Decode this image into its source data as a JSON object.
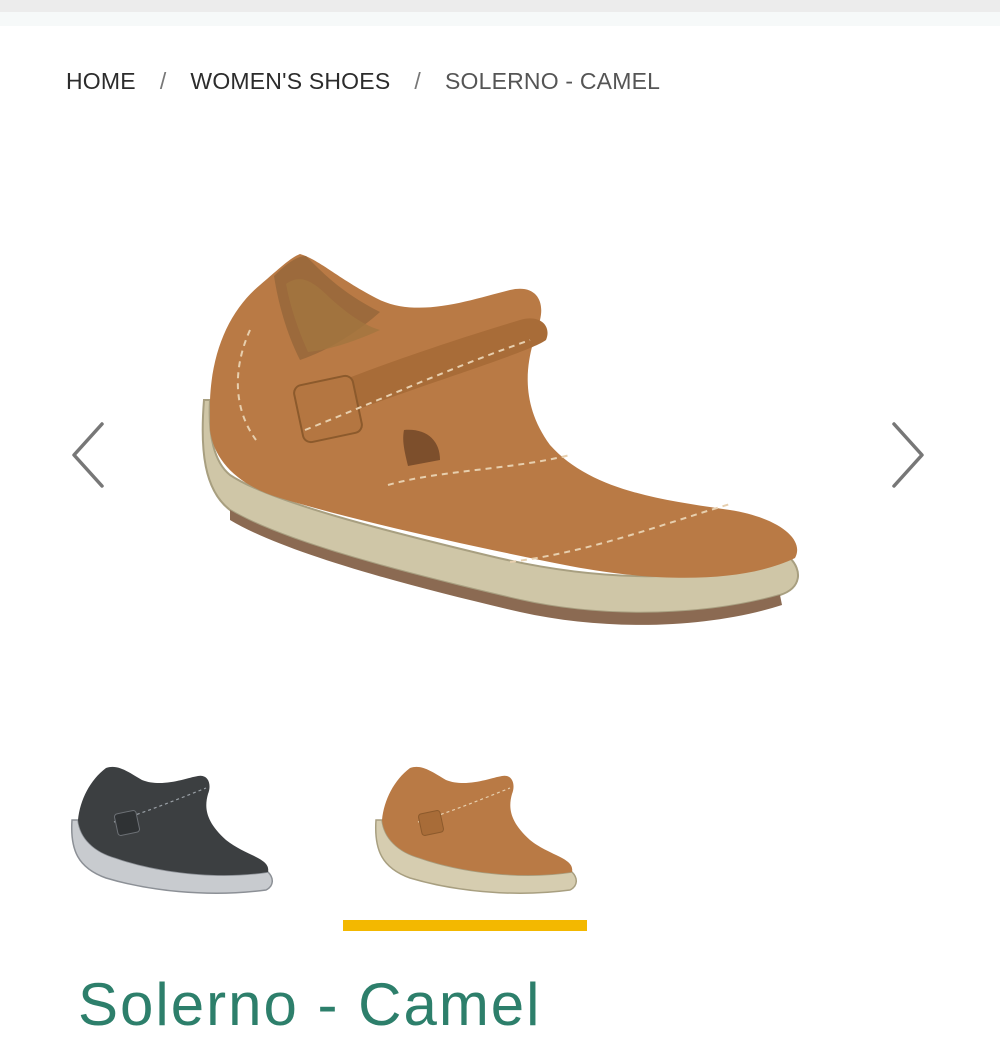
{
  "breadcrumb": {
    "home": "HOME",
    "category": "WOMEN'S SHOES",
    "current": "SOLERNO - CAMEL",
    "separator": "/"
  },
  "gallery": {
    "main_image_alt": "Solerno camel shoe",
    "prev_icon": "chevron-left-icon",
    "next_icon": "chevron-right-icon",
    "thumbnails": [
      {
        "alt": "Solerno black shoe",
        "color": "#3c3f41"
      },
      {
        "alt": "Solerno camel shoe",
        "color": "#b97a45",
        "selected": true
      }
    ],
    "indicator_color": "#f3b800"
  },
  "product": {
    "title": "Solerno - Camel",
    "title_color": "#2d7f6b"
  }
}
